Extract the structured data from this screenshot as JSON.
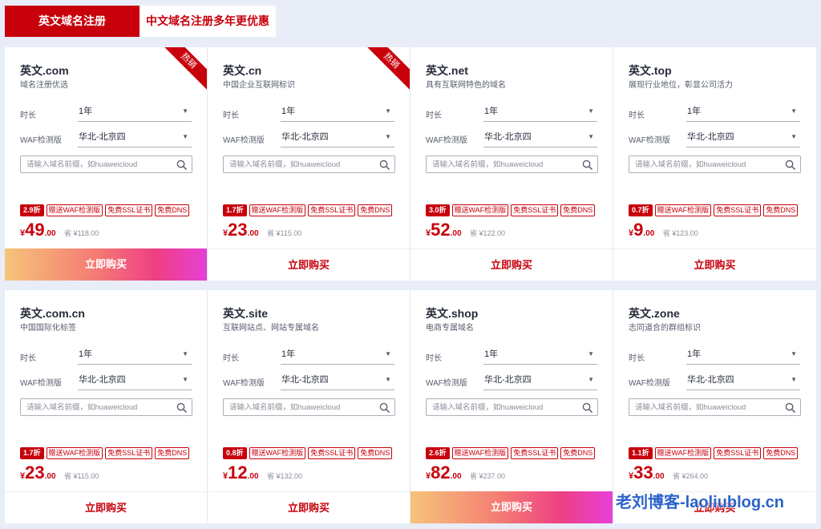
{
  "tabs": [
    {
      "label": "英文域名注册",
      "active": true
    },
    {
      "label": "中文域名注册多年更优惠",
      "active": false
    }
  ],
  "labels": {
    "duration": "时长",
    "waf": "WAF检测版",
    "buy": "立即购买",
    "save_prefix": "省 "
  },
  "colors": {
    "accent": "#c7000b",
    "background": "#e8edf7",
    "watermark": "#2b63c9"
  },
  "cards": [
    {
      "title": "英文.com",
      "subtitle": "域名注册优选",
      "hot": "热销",
      "duration": "1年",
      "region": "华北-北京四",
      "search_placeholder": "请输入域名前缀，如huaweicloud",
      "discount": "2.9折",
      "tags": [
        "赠送WAF检测版",
        "免费SSL证书",
        "免费DNS"
      ],
      "currency": "¥",
      "price_int": "49",
      "price_dec": ".00",
      "original": "¥118.00",
      "buy_gradient": true
    },
    {
      "title": "英文.cn",
      "subtitle": "中国企业互联网标识",
      "hot": "热销",
      "duration": "1年",
      "region": "华北-北京四",
      "search_placeholder": "请输入域名前缀，如huaweicloud",
      "discount": "1.7折",
      "tags": [
        "赠送WAF检测版",
        "免费SSL证书",
        "免费DNS"
      ],
      "currency": "¥",
      "price_int": "23",
      "price_dec": ".00",
      "original": "¥115.00",
      "buy_gradient": false
    },
    {
      "title": "英文.net",
      "subtitle": "具有互联网特色的域名",
      "hot": "",
      "duration": "1年",
      "region": "华北-北京四",
      "search_placeholder": "请输入域名前缀，如huaweicloud",
      "discount": "3.0折",
      "tags": [
        "赠送WAF检测版",
        "免费SSL证书",
        "免费DNS"
      ],
      "currency": "¥",
      "price_int": "52",
      "price_dec": ".00",
      "original": "¥122.00",
      "buy_gradient": false
    },
    {
      "title": "英文.top",
      "subtitle": "展现行业地位，彰显公司活力",
      "hot": "",
      "duration": "1年",
      "region": "华北-北京四",
      "search_placeholder": "请输入域名前缀，如huaweicloud",
      "discount": "0.7折",
      "tags": [
        "赠送WAF检测版",
        "免费SSL证书",
        "免费DNS"
      ],
      "currency": "¥",
      "price_int": "9",
      "price_dec": ".00",
      "original": "¥123.00",
      "buy_gradient": false
    },
    {
      "title": "英文.com.cn",
      "subtitle": "中国国际化标签",
      "hot": "",
      "duration": "1年",
      "region": "华北-北京四",
      "search_placeholder": "请输入域名前缀，如huaweicloud",
      "discount": "1.7折",
      "tags": [
        "赠送WAF检测版",
        "免费SSL证书",
        "免费DNS"
      ],
      "currency": "¥",
      "price_int": "23",
      "price_dec": ".00",
      "original": "¥115.00",
      "buy_gradient": false
    },
    {
      "title": "英文.site",
      "subtitle": "互联网站点、网站专属域名",
      "hot": "",
      "duration": "1年",
      "region": "华北-北京四",
      "search_placeholder": "请输入域名前缀，如huaweicloud",
      "discount": "0.8折",
      "tags": [
        "赠送WAF检测版",
        "免费SSL证书",
        "免费DNS"
      ],
      "currency": "¥",
      "price_int": "12",
      "price_dec": ".00",
      "original": "¥132.00",
      "buy_gradient": false
    },
    {
      "title": "英文.shop",
      "subtitle": "电商专属域名",
      "hot": "",
      "duration": "1年",
      "region": "华北-北京四",
      "search_placeholder": "请输入域名前缀，如huaweicloud",
      "discount": "2.6折",
      "tags": [
        "赠送WAF检测版",
        "免费SSL证书",
        "免费DNS"
      ],
      "currency": "¥",
      "price_int": "82",
      "price_dec": ".00",
      "original": "¥237.00",
      "buy_gradient": true
    },
    {
      "title": "英文.zone",
      "subtitle": "志同道合的群组标识",
      "hot": "",
      "duration": "1年",
      "region": "华北-北京四",
      "search_placeholder": "请输入域名前缀，如huaweicloud",
      "discount": "1.1折",
      "tags": [
        "赠送WAF检测版",
        "免费SSL证书",
        "免费DNS"
      ],
      "currency": "¥",
      "price_int": "33",
      "price_dec": ".00",
      "original": "¥264.00",
      "buy_gradient": false
    }
  ],
  "watermark": "老刘博客-laoliublog.cn"
}
